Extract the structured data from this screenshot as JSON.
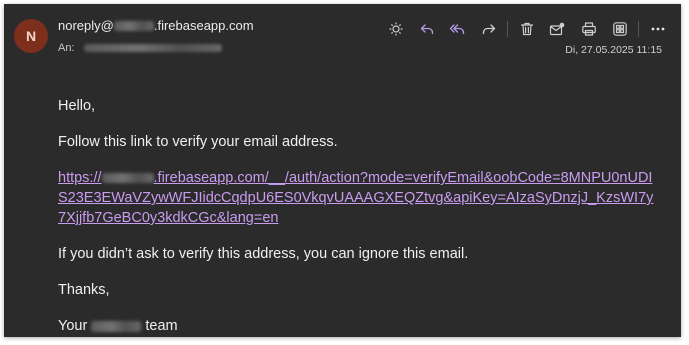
{
  "header": {
    "avatar_initial": "N",
    "sender_prefix": "noreply@",
    "sender_suffix": ".firebaseapp.com",
    "recipient_label": "An:",
    "date": "Di, 27.05.2025 11:15"
  },
  "toolbar": {
    "icons": [
      "sun-icon",
      "reply-icon",
      "reply-all-icon",
      "forward-icon",
      "delete-icon",
      "mark-unread-icon",
      "print-icon",
      "apps-icon",
      "more-icon"
    ],
    "icon_color": "#b59be8"
  },
  "body": {
    "greeting": "Hello,",
    "instruction": "Follow this link to verify your email address.",
    "link_prefix": "https://",
    "link_rest": ".firebaseapp.com/__/auth/action?mode=verifyEmail&oobCode=8MNPU0nUDIS23E3EWaVZywWFJIidcCqdpU6ES0VkqvUAAAGXEQZtvg&apiKey=AIzaSyDnzjJ_KzsWI7y7Xjjfb7GeBC0y3kdkCGc&lang=en",
    "ignore_note": "If you didn’t ask to verify this address, you can ignore this email.",
    "thanks": "Thanks,",
    "signoff_prefix": "Your",
    "signoff_suffix": "team"
  }
}
